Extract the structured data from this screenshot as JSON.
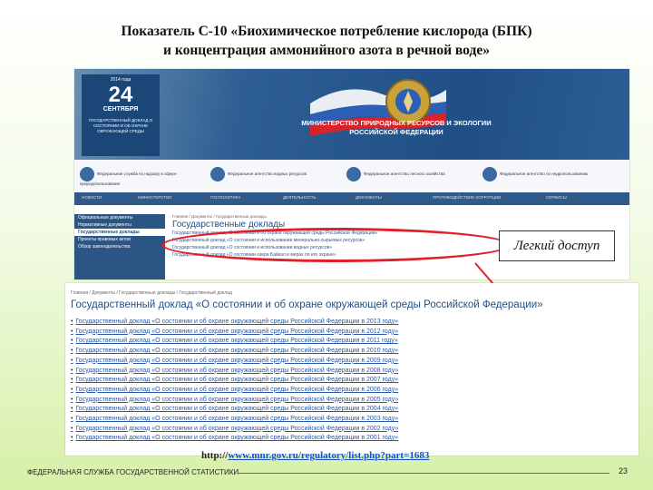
{
  "title": {
    "line1": "Показатель С-10 «Биохимическое потребление кислорода (БПК)",
    "line2": "и концентрация аммонийного азота в речной воде»"
  },
  "screenshot_top": {
    "date": {
      "day": "24",
      "month": "СЕНТЯБРЯ",
      "year_label": "2014 года",
      "desc": "ГОСУДАРСТВЕННЫЙ ДОКЛАД О СОСТОЯНИИ И ОБ ОХРАНЕ ОКРУЖАЮЩЕЙ СРЕДЫ"
    },
    "ministry": "МИНИСТЕРСТВО ПРИРОДНЫХ РЕСУРСОВ И ЭКОЛОГИИ РОССИЙСКОЙ ФЕДЕРАЦИИ",
    "agencies": [
      "Федеральная служба по надзору в сфере природопользования",
      "Федеральное агентство водных ресурсов",
      "Федеральное агентство лесного хозяйства",
      "Федеральное агентство по недропользованию"
    ],
    "nav": [
      "Новости",
      "Министерство",
      "Госполитика",
      "Деятельность",
      "Документы",
      "Противодействие коррупции",
      "Сервисы"
    ],
    "sidebar": [
      "Официальные документы",
      "Нормативные документы",
      "Государственные доклады",
      "Проекты правовых актов",
      "Обзор законодательства"
    ],
    "breadcrumb": "Главная / Документы / Государственные доклады",
    "heading": "Государственные доклады",
    "links": [
      "Государственный доклад «О состоянии и об охране окружающей среды Российской Федерации»",
      "Государственный доклад «О состоянии и использовании минерально-сырьевых ресурсов»",
      "Государственный доклад «О состоянии и использовании водных ресурсов»",
      "Государственный доклад «О состоянии озера Байкал и мерах по его охране»"
    ]
  },
  "callout": "Легкий доступ",
  "screenshot_bottom": {
    "breadcrumb": "Главная / Документы / Государственные доклады / Государственный доклад",
    "heading": "Государственный доклад «О состоянии и об охране окружающей среды Российской Федерации»",
    "reports": [
      "Государственный доклад «О состоянии и об охране окружающей среды Российской Федерации в 2013 году»",
      "Государственный доклад «О состоянии и об охране окружающей среды Российской Федерации в 2012 году»",
      "Государственный доклад «О состоянии и об охране окружающей среды Российской Федерации в 2011 году»",
      "Государственный доклад «О состоянии и об охране окружающей среды Российской Федерации в 2010 году»",
      "Государственный доклад «О состоянии и об охране окружающей среды Российской Федерации в 2009 году»",
      "Государственный доклад «О состоянии и об охране окружающей среды Российской Федерации в 2008 году»",
      "Государственный доклад «О состоянии и об охране окружающей среды Российской Федерации в 2007 году»",
      "Государственный доклад «О состоянии и об охране окружающей среды Российской Федерации в 2006 году»",
      "Государственный доклад «О состоянии и об охране окружающей среды Российской Федерации в 2005 году»",
      "Государственный доклад «О состоянии и об охране окружающей среды Российской Федерации в 2004 году»",
      "Государственный доклад «О состоянии и об охране окружающей среды Российской Федерации в 2003 году»",
      "Государственный доклад «О состоянии и об охране окружающей среды Российской Федерации в 2002 году»",
      "Государственный доклад «О состоянии и об охране окружающей среды Российской Федерации в 2001 году»"
    ]
  },
  "url": {
    "prefix": "http://",
    "link": "www.mnr.gov.ru/regulatory/list.php?part=1683"
  },
  "footer": {
    "org": "ФЕДЕРАЛЬНАЯ СЛУЖБА ГОСУДАРСТВЕННОЙ СТАТИСТИКИ",
    "page": "23"
  },
  "colors": {
    "accent": "#1f4f86",
    "highlight": "#e02028",
    "link": "#2a58a0"
  }
}
